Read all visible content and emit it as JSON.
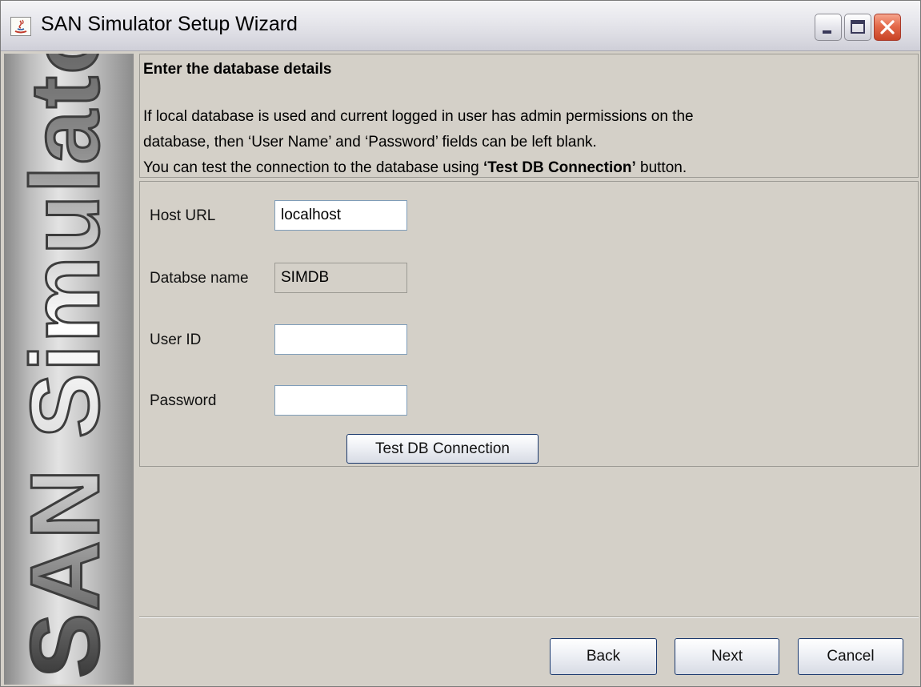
{
  "window": {
    "title": "SAN Simulator Setup Wizard",
    "controls": [
      "minimize",
      "maximize",
      "close"
    ]
  },
  "banner": {
    "text": "SAN Simulator"
  },
  "header": {
    "title": "Enter the database details",
    "description_line1": "If local database is used and current logged in user has admin permissions on the",
    "description_line2": "database, then ‘User Name’ and ‘Password’ fields can be left blank.",
    "description_line3_prefix": "You can test the connection to the database using ",
    "description_line3_bold": "‘Test DB Connection’",
    "description_line3_suffix": " button."
  },
  "form": {
    "host_label": "Host URL",
    "host_value": "localhost",
    "db_label": "Databse name",
    "db_value": "SIMDB",
    "user_label": "User ID",
    "user_value": "",
    "password_label": "Password",
    "password_value": "",
    "test_button": "Test DB Connection"
  },
  "footer": {
    "back": "Back",
    "next": "Next",
    "cancel": "Cancel"
  },
  "colors": {
    "window_bg": "#d4d0c8",
    "close_button": "#e46a4b",
    "field_border": "#7f9db9",
    "button_border": "#1c3a6e"
  }
}
